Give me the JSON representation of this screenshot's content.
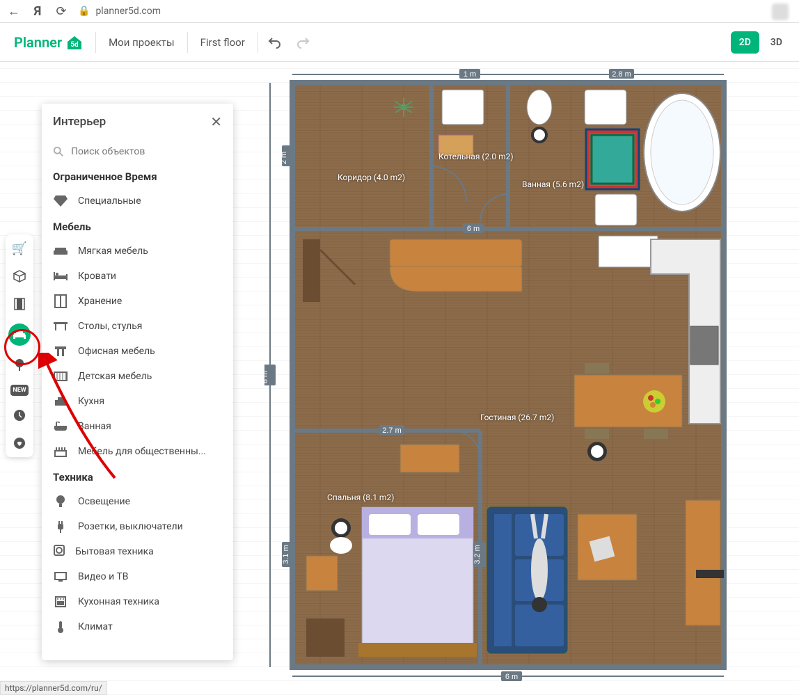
{
  "browser": {
    "url_host": "planner5d.com",
    "status_url": "https://planner5d.com/ru/"
  },
  "app": {
    "logo_text": "Planner",
    "logo_badge": "5d"
  },
  "toolbar": {
    "my_projects": "Мои проекты",
    "floor_label": "First floor",
    "view_2d": "2D",
    "view_3d": "3D"
  },
  "catalog": {
    "title": "Интерьер",
    "search_placeholder": "Поиск объектов",
    "sections": [
      {
        "heading": "Ограниченное Время",
        "items": [
          {
            "icon": "diamond",
            "label": "Специальные"
          }
        ]
      },
      {
        "heading": "Мебель",
        "items": [
          {
            "icon": "sofa",
            "label": "Мягкая мебель"
          },
          {
            "icon": "bed",
            "label": "Кровати"
          },
          {
            "icon": "storage",
            "label": "Хранение"
          },
          {
            "icon": "table",
            "label": "Столы, стулья"
          },
          {
            "icon": "office",
            "label": "Офисная мебель"
          },
          {
            "icon": "crib",
            "label": "Детская мебель"
          },
          {
            "icon": "kitchen",
            "label": "Кухня"
          },
          {
            "icon": "bath",
            "label": "Ванная"
          },
          {
            "icon": "public",
            "label": "Мебель для общественны..."
          }
        ]
      },
      {
        "heading": "Техника",
        "items": [
          {
            "icon": "bulb",
            "label": "Освещение"
          },
          {
            "icon": "plug",
            "label": "Розетки, выключатели"
          },
          {
            "icon": "appliance",
            "label": "Бытовая техника"
          },
          {
            "icon": "tv",
            "label": "Видео и ТВ"
          },
          {
            "icon": "oven",
            "label": "Кухонная техника"
          },
          {
            "icon": "thermo",
            "label": "Климат"
          }
        ]
      }
    ]
  },
  "rooms": {
    "corridor": "Коридор (4.0 m2)",
    "boiler": "Котельная (2.0 m2)",
    "bathroom": "Ванная (5.6 m2)",
    "living": "Гостиная (26.7 m2)",
    "bedroom": "Спальня (8.1 m2)"
  },
  "dimensions": {
    "top1": "1 m",
    "top2": "2.8 m",
    "left_main": "8 m",
    "left_boiler": "2 m",
    "inner_6m": "6 m",
    "bedroom_w": "2.7 m",
    "bedroom_h": "3.1 m",
    "living_h": "3.2 m",
    "bottom": "6 m"
  }
}
